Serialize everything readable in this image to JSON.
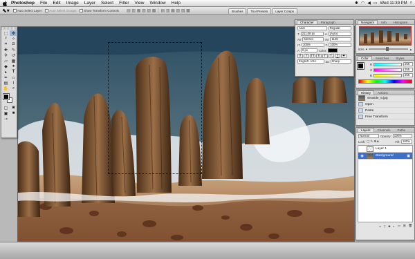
{
  "menubar": {
    "apple": "",
    "items": [
      "Photoshop",
      "File",
      "Edit",
      "Image",
      "Layer",
      "Select",
      "Filter",
      "View",
      "Window",
      "Help"
    ],
    "clock": "Wed 11:39 PM"
  },
  "options": {
    "auto_select_layer": "Auto Select Layer",
    "auto_select_groups": "Auto Select Groups",
    "show_transform": "Show Transform Controls",
    "well_tabs": [
      "Brushes",
      "Tool Presets",
      "Layer Comps"
    ]
  },
  "character": {
    "tabs": [
      "Character",
      "Paragraph"
    ],
    "font": "Arial",
    "style": "Regular",
    "size": "211.08 px",
    "leading": "(Auto)",
    "kerning": "Metrics",
    "tracking": "1129",
    "vscale": "100%",
    "hscale": "100%",
    "baseline": "0 px",
    "color_label": "Color:",
    "language": "English: USA",
    "aa": "aa",
    "antialias": "Sharp",
    "style_buttons": [
      "T",
      "T",
      "TT",
      "Tr",
      "T'",
      "T,",
      "T",
      "T"
    ]
  },
  "navigator": {
    "tabs": [
      "Navigator",
      "Info",
      "Histogram"
    ],
    "zoom": "50%"
  },
  "color": {
    "tabs": [
      "Color",
      "Swatches",
      "Styles"
    ],
    "channels": [
      {
        "label": "R",
        "value": "255"
      },
      {
        "label": "G",
        "value": "255"
      },
      {
        "label": "B",
        "value": "255"
      }
    ]
  },
  "history": {
    "tabs": [
      "History",
      "Actions"
    ],
    "document": "seaside_6.jpg",
    "steps": [
      "Open",
      "Paste",
      "Free Transform"
    ]
  },
  "layers": {
    "tabs": [
      "Layers",
      "Channels",
      "Paths"
    ],
    "blend_mode": "Normal",
    "opacity_label": "Opacity:",
    "opacity": "100%",
    "lock_label": "Lock:",
    "fill_label": "Fill:",
    "fill": "100%",
    "items": [
      {
        "name": "Layer 1",
        "visible": false
      },
      {
        "name": "Background",
        "visible": true
      }
    ]
  },
  "colors": {
    "selection": "#3d6fc8",
    "panel_bg": "#e4e4e4"
  }
}
